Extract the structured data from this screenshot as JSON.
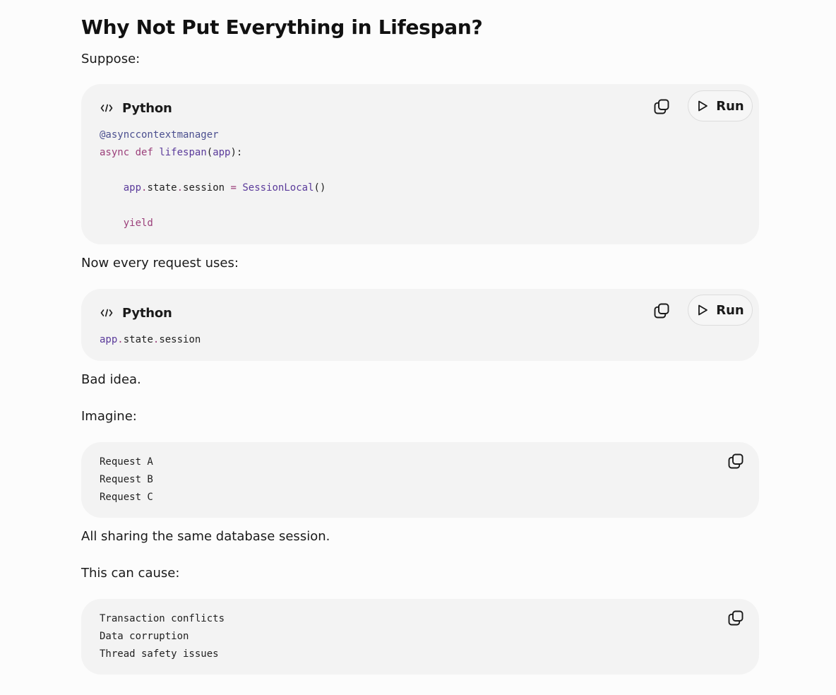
{
  "heading": "Why Not Put Everything in Lifespan?",
  "paragraphs": {
    "p1": "Suppose:",
    "p2": "Now every request uses:",
    "p3": "Bad idea.",
    "p4": "Imagine:",
    "p5": "All sharing the same database session.",
    "p6": "This can cause:"
  },
  "code_blocks": {
    "block1": {
      "language": "Python",
      "run_label": "Run",
      "lines": {
        "l1": {
          "decorator": "@asynccontextmanager"
        },
        "l2": {
          "kw1": "async",
          "kw2": "def",
          "fn": "lifespan",
          "p_open": "(",
          "arg": "app",
          "p_close": "):"
        },
        "l4": {
          "indent": "    ",
          "obj": "app",
          "dot1": ".",
          "attr1": "state",
          "dot2": ".",
          "attr2": "session",
          "eq": " = ",
          "cls": "SessionLocal",
          "call": "()"
        },
        "l6": {
          "indent": "    ",
          "kw": "yield"
        }
      }
    },
    "block2": {
      "language": "Python",
      "run_label": "Run",
      "lines": {
        "l1": {
          "obj": "app",
          "dot1": ".",
          "attr1": "state",
          "dot2": ".",
          "attr2": "session"
        }
      }
    },
    "block3": {
      "lines": [
        "Request A",
        "Request B",
        "Request C"
      ]
    },
    "block4": {
      "lines": [
        "Transaction conflicts",
        "Data corruption",
        "Thread safety issues"
      ]
    }
  },
  "icons": {
    "lang": "code-icon",
    "copy": "copy-icon",
    "run": "play-icon"
  }
}
